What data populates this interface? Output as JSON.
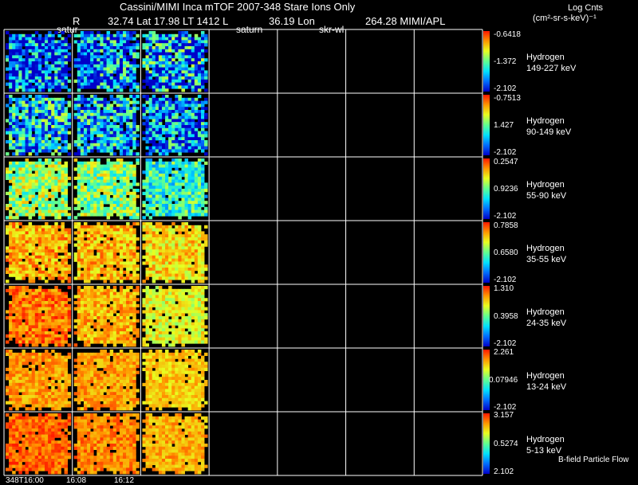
{
  "header": {
    "title": "Cassini/MIMI Inca mTOF  2007-348   Stare   Ions Only",
    "r_label": "R",
    "lat_lt_l": "32.74 Lat 17.98 LT 1412 L",
    "lon_label": "36.19 Lon",
    "mimi_apl": "264.28  MIMI/APL",
    "saturn_1": "satur",
    "saturn_2": "saturn",
    "skr": "skr-wl"
  },
  "colorbar_title": {
    "line1": "Log Cnts",
    "line2": "(cm²-sr-s-keV)⁻¹"
  },
  "footer": {
    "time_1": "348T16:00",
    "time_2": "16:08",
    "time_3": "16:12",
    "note": "B-field Particle Flow"
  },
  "chart_data": {
    "type": "heatmap",
    "colormap": [
      "#0000c8",
      "#0070ff",
      "#00e0ff",
      "#60ff90",
      "#e8ff20",
      "#ff9a00",
      "#ff1800"
    ],
    "grid_rows": 7,
    "grid_cols": 7,
    "filled_columns": 3,
    "panels": [
      {
        "species": "Hydrogen",
        "energy": "149-227 keV",
        "max": "-0.6418",
        "mid": "-1.372",
        "min": "-2.102",
        "level": [
          0.12,
          0.15,
          0.2
        ],
        "noise": 0.45
      },
      {
        "species": "Hydrogen",
        "energy": "90-149 keV",
        "max": "-0.7513",
        "mid": "1.427",
        "min": "-2.102",
        "level": [
          0.3,
          0.28,
          0.22
        ],
        "noise": 0.35
      },
      {
        "species": "Hydrogen",
        "energy": "55-90 keV",
        "max": "0.2547",
        "mid": "0.9236",
        "min": "-2.102",
        "level": [
          0.58,
          0.55,
          0.42
        ],
        "noise": 0.22
      },
      {
        "species": "Hydrogen",
        "energy": "35-55 keV",
        "max": "0.7858",
        "mid": "0.6580",
        "min": "-2.102",
        "level": [
          0.8,
          0.78,
          0.74
        ],
        "noise": 0.15
      },
      {
        "species": "Hydrogen",
        "energy": "24-35 keV",
        "max": "1.310",
        "mid": "0.3958",
        "min": "-2.102",
        "level": [
          0.88,
          0.8,
          0.68
        ],
        "noise": 0.13
      },
      {
        "species": "Hydrogen",
        "energy": "13-24 keV",
        "max": "2.261",
        "mid": "0.07946",
        "min": "-2.102",
        "level": [
          0.82,
          0.82,
          0.76
        ],
        "noise": 0.1
      },
      {
        "species": "Hydrogen",
        "energy": "5-13 keV",
        "max": "3.157",
        "mid": "0.5274",
        "min": "2.102",
        "level": [
          0.9,
          0.86,
          0.8
        ],
        "noise": 0.1
      }
    ]
  }
}
